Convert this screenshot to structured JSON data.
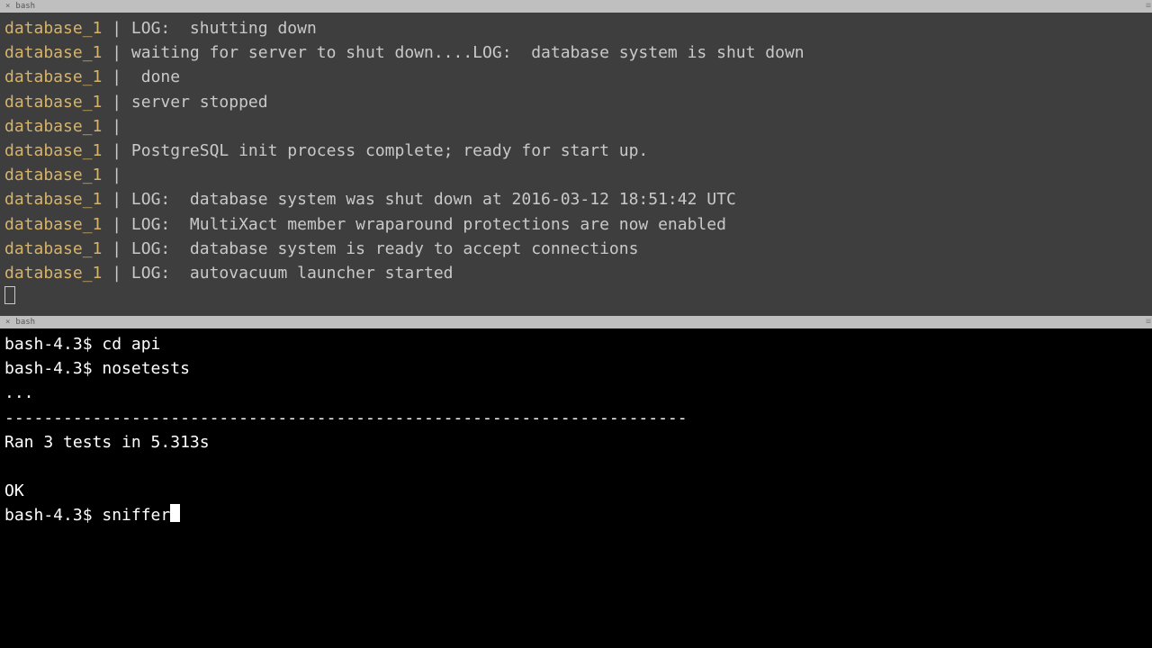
{
  "top": {
    "tab_label": "bash",
    "prefix": "database_1",
    "sep": " | ",
    "lines": [
      "LOG:  shutting down",
      "waiting for server to shut down....LOG:  database system is shut down",
      " done",
      "server stopped",
      "",
      "PostgreSQL init process complete; ready for start up.",
      "",
      "LOG:  database system was shut down at 2016-03-12 18:51:42 UTC",
      "LOG:  MultiXact member wraparound protections are now enabled",
      "LOG:  database system is ready to accept connections",
      "LOG:  autovacuum launcher started"
    ]
  },
  "bottom": {
    "tab_label": "bash",
    "prompt": "bash-4.3$ ",
    "lines": [
      {
        "type": "cmd",
        "text": "cd api"
      },
      {
        "type": "cmd",
        "text": "nosetests"
      },
      {
        "type": "out",
        "text": "..."
      },
      {
        "type": "out",
        "text": "----------------------------------------------------------------------"
      },
      {
        "type": "out",
        "text": "Ran 3 tests in 5.313s"
      },
      {
        "type": "blank",
        "text": ""
      },
      {
        "type": "out",
        "text": "OK"
      },
      {
        "type": "input",
        "text": "sniffer"
      }
    ]
  }
}
